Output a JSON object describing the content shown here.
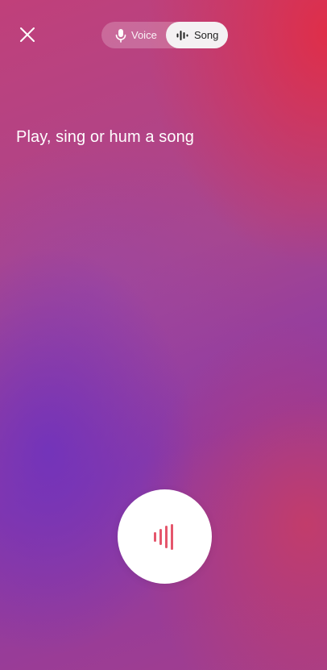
{
  "header": {
    "close_icon": "close-icon",
    "mode_toggle": {
      "options": [
        {
          "label": "Voice",
          "icon": "microphone-icon",
          "selected": false
        },
        {
          "label": "Song",
          "icon": "waveform-icon",
          "selected": true
        }
      ]
    }
  },
  "main": {
    "prompt_text": "Play, sing or hum a song"
  },
  "listen_button": {
    "icon": "sound-bars-icon",
    "icon_color": "#e5566c"
  },
  "colors": {
    "background_top_right": "#e12d46",
    "background_mid": "#a8468e",
    "background_bottom_left": "#6e32be",
    "toggle_selected_bg": "#f4f1f3",
    "text": "#ffffff"
  }
}
